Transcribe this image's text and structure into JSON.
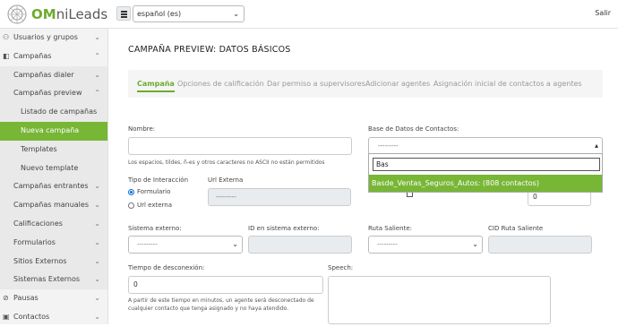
{
  "header": {
    "logo_prefix": "OM",
    "logo_suffix": "niLeads",
    "language": "español (es)",
    "logout": "Salir"
  },
  "sidebar": {
    "items": [
      {
        "label": "Usuarios y grupos"
      },
      {
        "label": "Campañas"
      },
      {
        "label": "Campañas dialer"
      },
      {
        "label": "Campañas preview"
      },
      {
        "label": "Listado de campañas"
      },
      {
        "label": "Nueva campaña"
      },
      {
        "label": "Templates"
      },
      {
        "label": "Nuevo template"
      },
      {
        "label": "Campañas entrantes"
      },
      {
        "label": "Campañas manuales"
      },
      {
        "label": "Calificaciones"
      },
      {
        "label": "Formularios"
      },
      {
        "label": "Sitios Externos"
      },
      {
        "label": "Sistemas Externos"
      },
      {
        "label": "Pausas"
      },
      {
        "label": "Contactos"
      }
    ]
  },
  "page": {
    "title": "CAMPAÑA PREVIEW: DATOS BÁSICOS",
    "tabs": [
      {
        "label": "Campaña"
      },
      {
        "label": "Opciones de calificación"
      },
      {
        "label": "Dar permiso a supervisores"
      },
      {
        "label": "Adicionar agentes"
      },
      {
        "label": "Asignación inicial de contactos a agentes"
      }
    ]
  },
  "form": {
    "nombre_label": "Nombre:",
    "nombre_value": "",
    "nombre_hint": "Los espacios, tildes, ñ-es y otros caracteres no ASCII no están permitidos",
    "base_label": "Base de Datos de Contactos:",
    "base_value": "---------",
    "base_search": "Bas",
    "base_option": "Basde_Ventas_Seguros_Autos: (808 contactos)",
    "tipo_label": "Tipo de Interacción",
    "tipo_formulario": "Formulario",
    "tipo_url": "Url externa",
    "url_label": "Url Externa",
    "url_value": "---------",
    "number_value": "0",
    "sistema_label": "Sistema externo:",
    "sistema_value": "---------",
    "id_sistema_label": "ID en sistema externo:",
    "ruta_label": "Ruta Saliente:",
    "ruta_value": "---------",
    "cid_label": "CID Ruta Saliente",
    "tiempo_label": "Tiempo de desconexión:",
    "tiempo_value": "0",
    "tiempo_hint": "A partir de este tiempo en minutos, un agente será desconectado de cualquier contacto que tenga asignado y no haya atendido.",
    "speech_label": "Speech:"
  },
  "colors": {
    "brand_green": "#78b636",
    "tab_active": "#6cab2d"
  }
}
